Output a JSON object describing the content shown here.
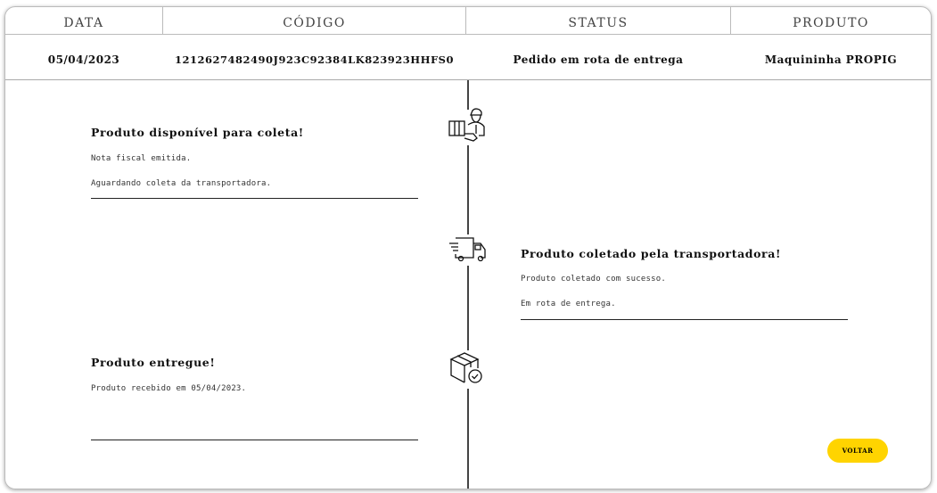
{
  "header": {
    "data": "DATA",
    "codigo": "CÓDIGO",
    "status": "STATUS",
    "produto": "PRODUTO"
  },
  "row": {
    "data": "05/04/2023",
    "codigo": "1212627482490J923C92384LK823923HHFS0",
    "status": "Pedido em rota de entrega",
    "produto": "Maquininha PROPIG"
  },
  "timeline": [
    {
      "title": "Produto disponível para coleta!",
      "lines": [
        "Nota fiscal emitida.",
        "Aguardando coleta da transportadora."
      ],
      "icon": "delivery-person-icon"
    },
    {
      "title": "Produto coletado pela transportadora!",
      "lines": [
        "Produto coletado com sucesso.",
        "Em rota de entrega."
      ],
      "icon": "truck-icon"
    },
    {
      "title": "Produto entregue!",
      "lines": [
        "Produto recebido em 05/04/2023."
      ],
      "icon": "box-check-icon"
    }
  ],
  "button": {
    "label": "VOLTAR",
    "color": "#FFD400"
  }
}
